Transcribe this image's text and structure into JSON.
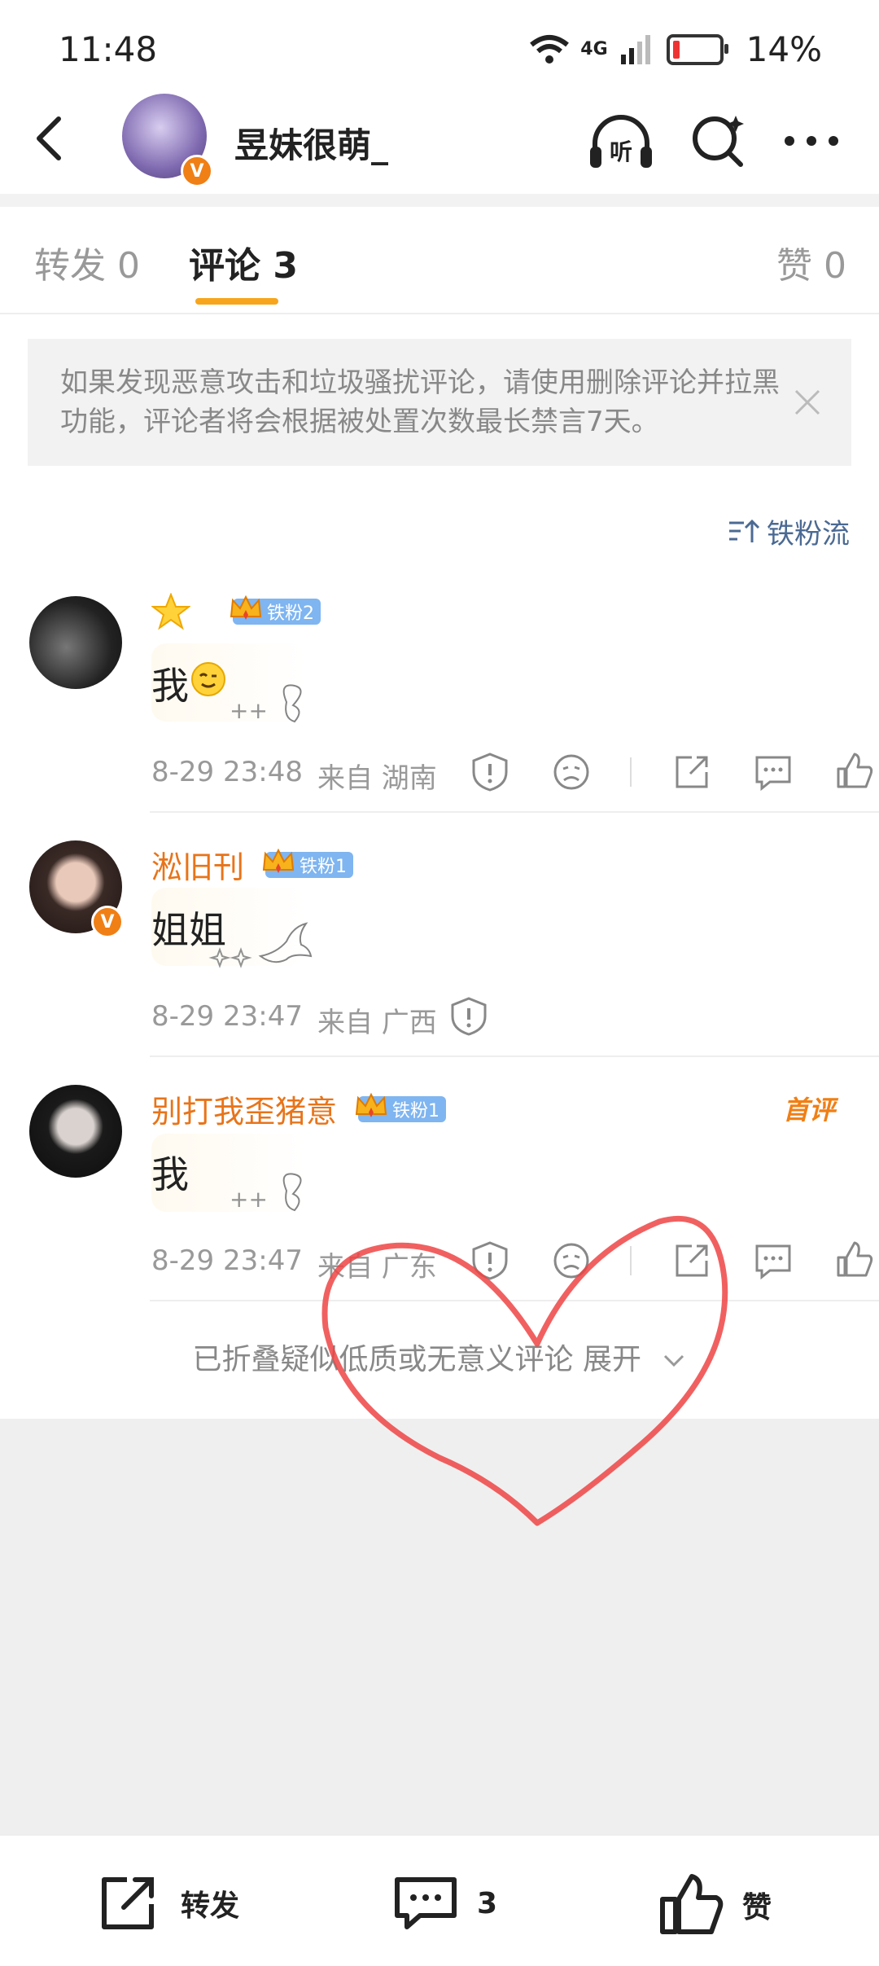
{
  "status_bar": {
    "time": "11:48",
    "network": "4G",
    "battery": "14%"
  },
  "header": {
    "username": "昱妹很萌_",
    "listen_label": "听",
    "verified": "V"
  },
  "tabs": [
    {
      "label": "转发 0"
    },
    {
      "label": "评论 3"
    },
    {
      "label": "赞 0"
    }
  ],
  "notice": {
    "text": "如果发现恶意攻击和垃圾骚扰评论，请使用删除评论并拉黑功能，评论者将会根据被处置次数最长禁言7天。"
  },
  "sort": {
    "label": "铁粉流"
  },
  "comments": [
    {
      "name": "",
      "fan_badge": "铁粉2",
      "text": "我",
      "time": "8-29 23:48",
      "location": "来自 湖南"
    },
    {
      "name": "淞旧刊",
      "fan_badge": "铁粉1",
      "text": "姐姐",
      "time": "8-29 23:47",
      "location": "来自 广西"
    },
    {
      "name": "别打我歪猪意",
      "fan_badge": "铁粉1",
      "text": "我",
      "time": "8-29 23:47",
      "location": "来自 广东",
      "tag": "首评"
    }
  ],
  "collapsed": {
    "text": "已折叠疑似低质或无意义评论 展开"
  },
  "bottom_bar": {
    "repost": "转发",
    "comment_count": "3",
    "like": "赞"
  }
}
